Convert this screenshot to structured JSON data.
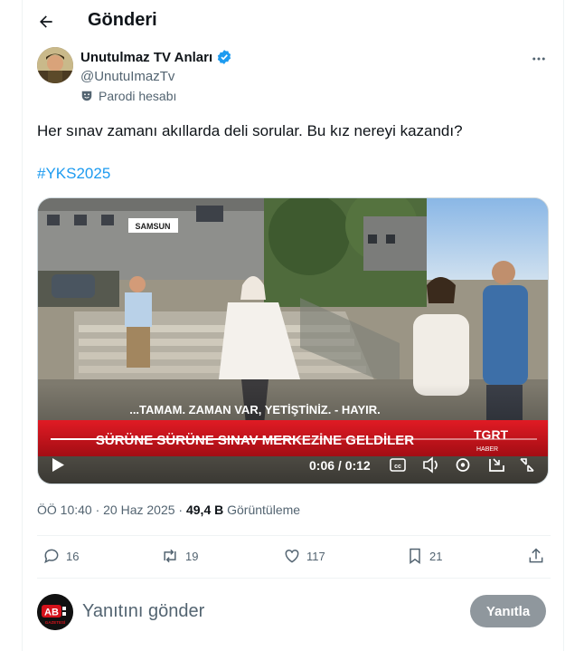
{
  "header": {
    "title": "Gönderi",
    "back_icon": "arrow-left-icon"
  },
  "author": {
    "display_name": "Unutulmaz TV Anları",
    "handle": "@UnutuImazTv",
    "verified_icon": "verified-badge-icon",
    "parody_label": "Parodi hesabı",
    "parody_icon": "mask-icon"
  },
  "post": {
    "text": "Her sınav zamanı akıllarda deli sorular. Bu kız nereyi kazandı?",
    "hashtag": "#YKS2025"
  },
  "video": {
    "location_sign": "SAMSUN",
    "subtitle": "...TAMAM. ZAMAN VAR, YETİŞTİNİZ. - HAYIR.",
    "headline": "SÜRÜNE SÜRÜNE SINAV MERKEZİNE GELDİLER",
    "channel_top": "TGRT",
    "channel_bottom": "HABER",
    "time": "0:06 / 0:12",
    "progress": 0.5
  },
  "meta": {
    "datetime": "ÖÖ 10:40 · 20 Haz 2025 · ",
    "views": "49,4 B",
    "views_label": " Görüntüleme"
  },
  "actions": {
    "replies": "16",
    "reposts": "19",
    "likes": "117",
    "bookmarks": "21"
  },
  "reply": {
    "placeholder": "Yanıtını gönder",
    "button": "Yanıtla",
    "avatar_text": "AB",
    "avatar_sub": "GAZETESİ"
  },
  "colors": {
    "accent": "#1d9bf0",
    "headline_red": "#c8101a"
  }
}
